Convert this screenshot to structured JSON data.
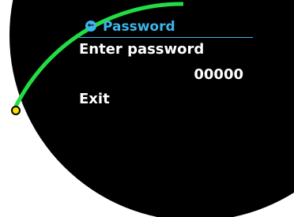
{
  "colors": {
    "screen_background": "#000000",
    "page_background": "#ffffff",
    "accent": "#3bb6ea",
    "text": "#ffffff",
    "arc": "#22dd44",
    "indicator": "#ffdd00"
  },
  "header": {
    "icon": "back-arrow-icon",
    "title": "Password"
  },
  "menu": {
    "prompt_label": "Enter password",
    "password_value": "00000",
    "exit_label": "Exit"
  },
  "scroll_indicator": {
    "progress": 0.25
  }
}
